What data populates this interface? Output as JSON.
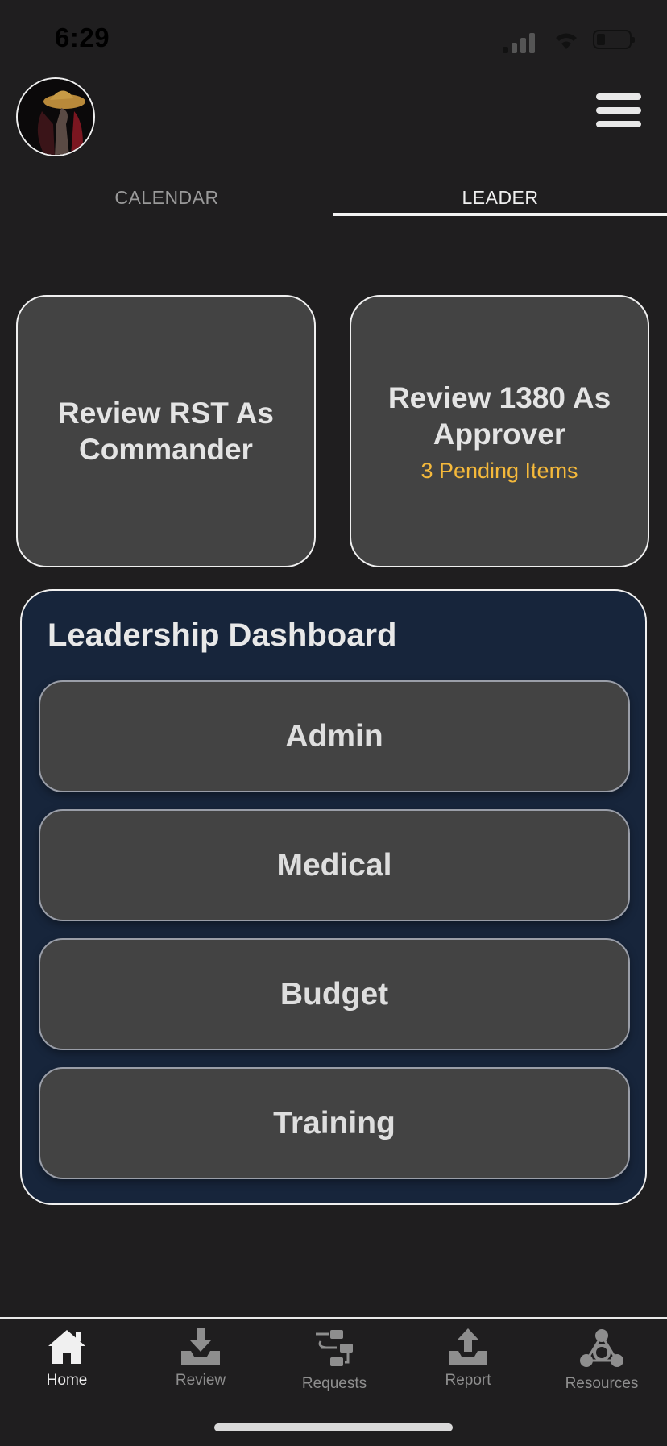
{
  "status_bar": {
    "time": "6:29"
  },
  "header": {
    "avatar_alt": "profile",
    "menu_icon": "hamburger-menu-icon"
  },
  "tabs": [
    {
      "label": "CALENDAR",
      "active": false
    },
    {
      "label": "LEADER",
      "active": true
    }
  ],
  "review_cards": {
    "rst": {
      "title": "Review RST As Commander"
    },
    "approver": {
      "title": "Review 1380 As Approver",
      "subtitle": "3 Pending Items"
    }
  },
  "dashboard": {
    "title": "Leadership Dashboard",
    "buttons": [
      "Admin",
      "Medical",
      "Budget",
      "Training"
    ]
  },
  "bottom_nav": [
    {
      "label": "Home",
      "icon": "home-icon",
      "active": true
    },
    {
      "label": "Review",
      "icon": "inbox-download-icon",
      "active": false
    },
    {
      "label": "Requests",
      "icon": "workflow-icon",
      "active": false
    },
    {
      "label": "Report",
      "icon": "upload-tray-icon",
      "active": false
    },
    {
      "label": "Resources",
      "icon": "network-icon",
      "active": false
    }
  ],
  "colors": {
    "background": "#1f1e1f",
    "card": "#434343",
    "dashboard_bg": "#17253b",
    "pending_accent": "#f5b93b"
  }
}
